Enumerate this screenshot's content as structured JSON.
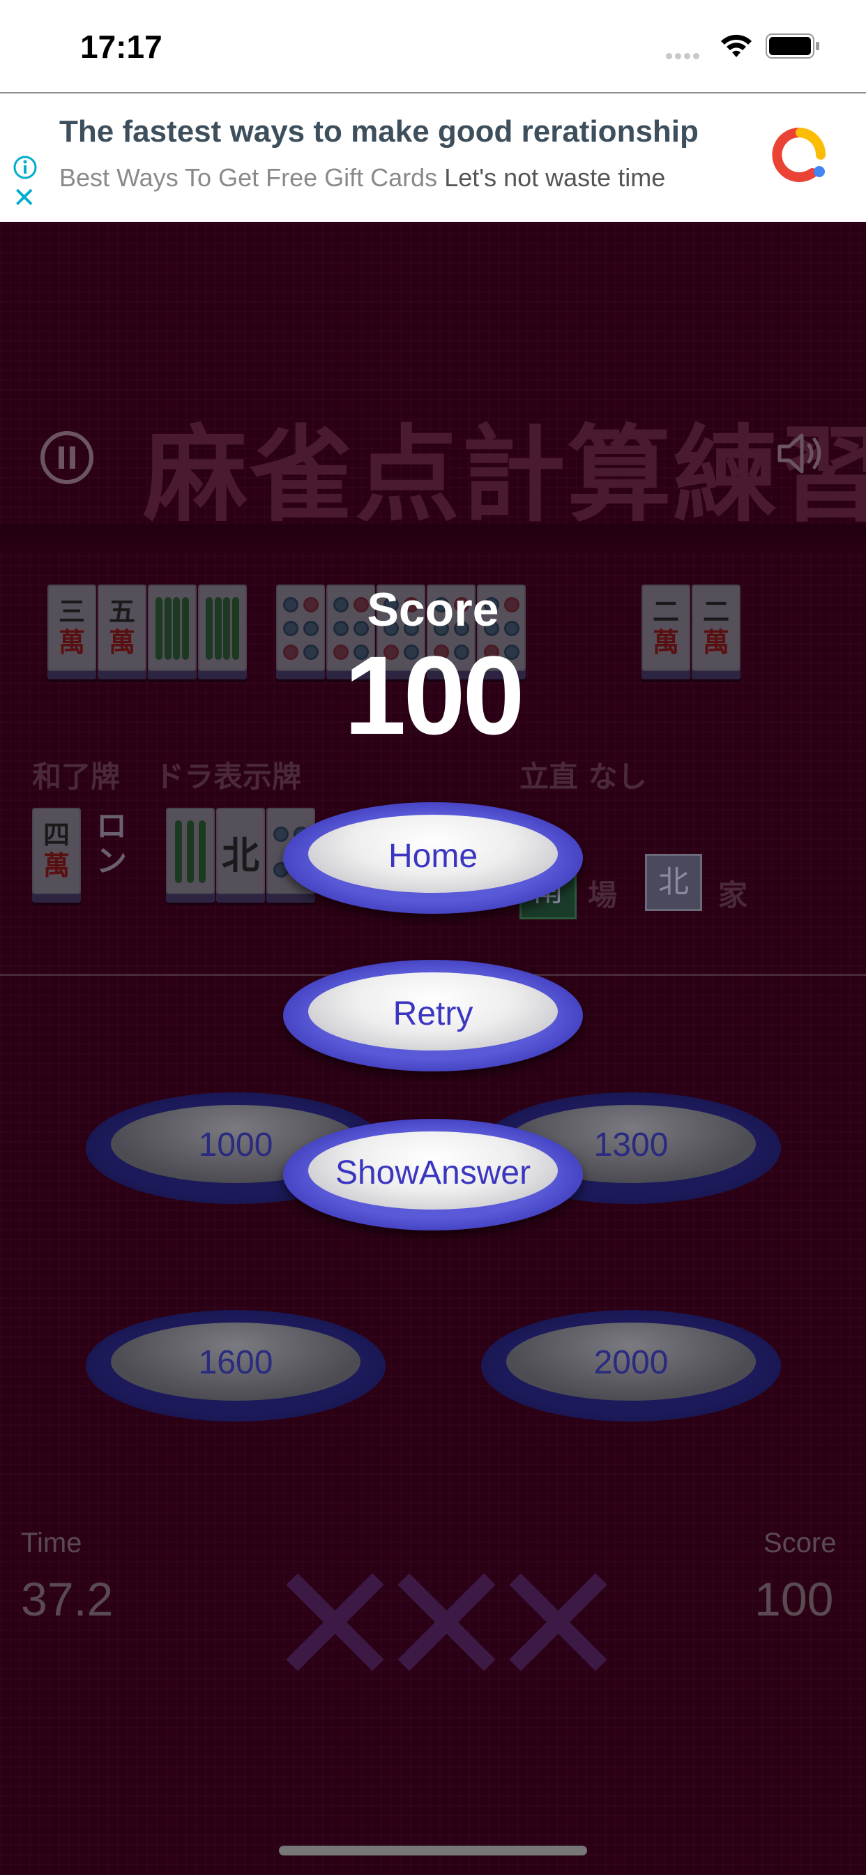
{
  "status_bar": {
    "time": "17:17"
  },
  "ad": {
    "title": "The fastest ways to make good rerationship",
    "subtitle_gray": "Best Ways To Get Free Gift Cards",
    "subtitle_dark": "Let's not waste time"
  },
  "game": {
    "title": "麻雀点計算練習",
    "hand_tiles": [
      {
        "type": "man",
        "top": "三",
        "bottom": "萬"
      },
      {
        "type": "man",
        "top": "五",
        "bottom": "萬"
      },
      {
        "type": "sou8"
      },
      {
        "type": "sou8"
      },
      {
        "type": "pin"
      },
      {
        "type": "pin"
      },
      {
        "type": "pin"
      },
      {
        "type": "pin"
      },
      {
        "type": "pin"
      },
      {
        "type": "man",
        "top": "二",
        "bottom": "萬"
      },
      {
        "type": "man",
        "top": "二",
        "bottom": "萬"
      }
    ],
    "labels": {
      "winning_tile": "和了牌",
      "dora_indicator": "ドラ表示牌",
      "riichi": "立直 なし",
      "ron": "ロン",
      "ba": "場",
      "ie": "家"
    },
    "winning_tile": {
      "top": "四",
      "bottom": "萬"
    },
    "dora_tiles": [
      "",
      "北",
      ""
    ],
    "round_wind": "南",
    "seat_wind": "北"
  },
  "answers": [
    "1000",
    "1300",
    "1600",
    "2000"
  ],
  "overlay": {
    "score_label": "Score",
    "score_value": "100",
    "home_label": "Home",
    "retry_label": "Retry",
    "show_answer_label": "ShowAnswer"
  },
  "footer": {
    "time_label": "Time",
    "time_value": "37.2",
    "score_label": "Score",
    "score_value": "100",
    "miss_marks": [
      "✕",
      "✕",
      "✕"
    ]
  },
  "colors": {
    "background": "#2b0014",
    "button_ring": "#3b38b8",
    "button_text": "#3a36c0",
    "ad_accent": "#00aecd"
  }
}
